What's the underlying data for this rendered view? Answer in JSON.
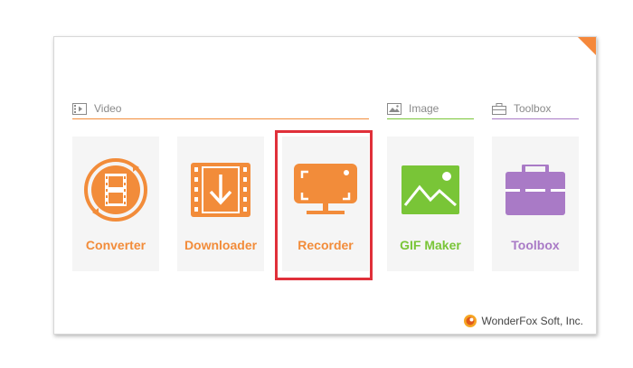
{
  "colors": {
    "video": "#f28c3a",
    "image": "#79c537",
    "toolbox": "#a97ac6",
    "highlight": "#e0303a"
  },
  "sections": {
    "video": {
      "label": "Video",
      "icon": "video-film-icon"
    },
    "image": {
      "label": "Image",
      "icon": "image-icon"
    },
    "toolbox": {
      "label": "Toolbox",
      "icon": "toolbox-small-icon"
    }
  },
  "tiles": {
    "converter": {
      "label": "Converter",
      "icon": "converter-film-icon"
    },
    "downloader": {
      "label": "Downloader",
      "icon": "download-arrow-icon"
    },
    "recorder": {
      "label": "Recorder",
      "icon": "screen-record-icon"
    },
    "gif_maker": {
      "label": "GIF Maker",
      "icon": "landscape-picture-icon"
    },
    "toolbox": {
      "label": "Toolbox",
      "icon": "toolbox-case-icon"
    }
  },
  "footer": {
    "brand": "WonderFox Soft, Inc.",
    "logo": "wonderfox-logo-icon"
  }
}
